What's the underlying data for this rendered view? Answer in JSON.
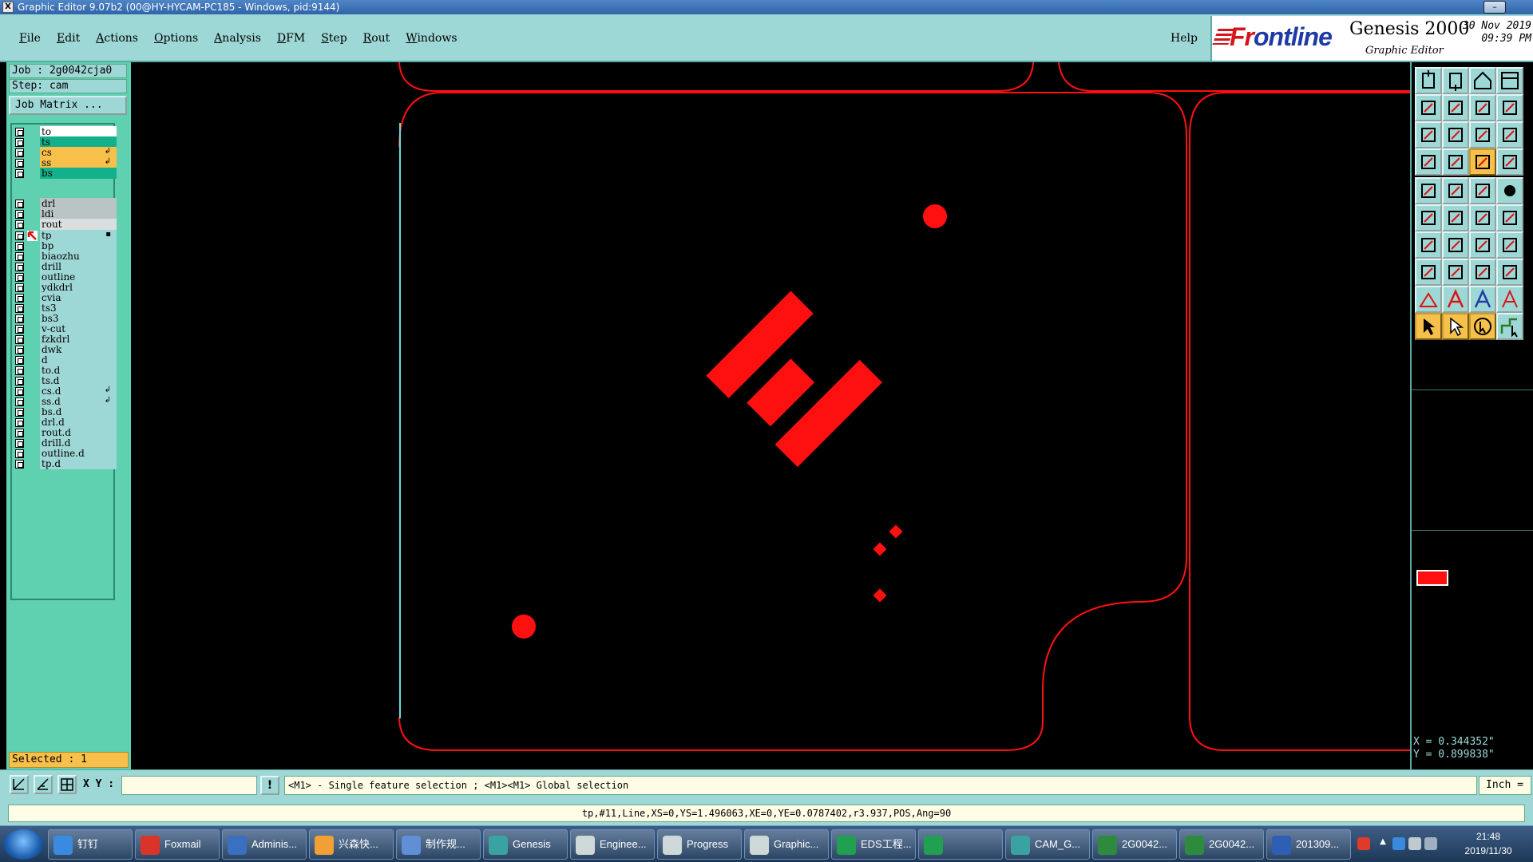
{
  "window": {
    "title": "Graphic Editor 9.07b2 (00@HY-HYCAM-PC185 - Windows, pid:9144)",
    "app_icon": "X"
  },
  "menus": [
    "File",
    "Edit",
    "Actions",
    "Options",
    "Analysis",
    "DFM",
    "Step",
    "Rout",
    "Windows"
  ],
  "help": "Help",
  "brand": {
    "logo": "Frontline",
    "product": "Genesis 2000",
    "subtitle": "Graphic Editor",
    "date": "30 Nov 2019",
    "time": "09:39 PM"
  },
  "job": {
    "job_label": "Job : 2g0042cja0",
    "step_label": "Step: cam",
    "matrix_button": "Job Matrix ..."
  },
  "layers": [
    {
      "name": "to",
      "color": "#ffffff",
      "flag": ""
    },
    {
      "name": "ts",
      "color": "#13b08c",
      "flag": ""
    },
    {
      "name": "cs",
      "color": "#f7c04a",
      "flag": "↲"
    },
    {
      "name": "ss",
      "color": "#f7c04a",
      "flag": "↲"
    },
    {
      "name": "bs",
      "color": "#13b08c",
      "flag": ""
    },
    {
      "name": "drl",
      "color": "#b9c4c4",
      "flag": ""
    },
    {
      "name": "ldi",
      "color": "#b9c4c4",
      "flag": ""
    },
    {
      "name": "rout",
      "color": "#d9dede",
      "flag": ""
    },
    {
      "name": "tp",
      "color": "#9ed8d6",
      "flag": "▪",
      "work": true
    },
    {
      "name": "bp",
      "color": "#9ed8d6",
      "flag": ""
    },
    {
      "name": "biaozhu",
      "color": "#9ed8d6",
      "flag": ""
    },
    {
      "name": "drill",
      "color": "#9ed8d6",
      "flag": ""
    },
    {
      "name": "outline",
      "color": "#9ed8d6",
      "flag": ""
    },
    {
      "name": "ydkdrl",
      "color": "#9ed8d6",
      "flag": ""
    },
    {
      "name": "cvia",
      "color": "#9ed8d6",
      "flag": ""
    },
    {
      "name": "ts3",
      "color": "#9ed8d6",
      "flag": ""
    },
    {
      "name": "bs3",
      "color": "#9ed8d6",
      "flag": ""
    },
    {
      "name": "v-cut",
      "color": "#9ed8d6",
      "flag": ""
    },
    {
      "name": "fzkdrl",
      "color": "#9ed8d6",
      "flag": ""
    },
    {
      "name": "dwk",
      "color": "#9ed8d6",
      "flag": ""
    },
    {
      "name": "d",
      "color": "#9ed8d6",
      "flag": ""
    },
    {
      "name": "to.d",
      "color": "#9ed8d6",
      "flag": ""
    },
    {
      "name": "ts.d",
      "color": "#9ed8d6",
      "flag": ""
    },
    {
      "name": "cs.d",
      "color": "#9ed8d6",
      "flag": "↲"
    },
    {
      "name": "ss.d",
      "color": "#9ed8d6",
      "flag": "↲"
    },
    {
      "name": "bs.d",
      "color": "#9ed8d6",
      "flag": ""
    },
    {
      "name": "drl.d",
      "color": "#9ed8d6",
      "flag": ""
    },
    {
      "name": "rout.d",
      "color": "#9ed8d6",
      "flag": ""
    },
    {
      "name": "drill.d",
      "color": "#9ed8d6",
      "flag": ""
    },
    {
      "name": "outline.d",
      "color": "#9ed8d6",
      "flag": ""
    },
    {
      "name": "tp.d",
      "color": "#9ed8d6",
      "flag": ""
    }
  ],
  "selected": "Selected : 1",
  "tools": [
    [
      "zoom-home-icon",
      "zoom-back-icon",
      "house-icon",
      "window-icon"
    ],
    [
      "pan-left-icon",
      "pan-right-icon",
      "pan-center-icon",
      "scale-icon"
    ],
    [
      "fit-icon",
      "fit-profile-icon",
      "ratio-1-2-icon",
      "help-icon"
    ],
    [
      "snap-icon",
      "grid-icon",
      "net-icon",
      "net-alt-icon"
    ],
    [
      "pad-add-icon",
      "shape-icon",
      "line-ruler-icon",
      "dot-icon"
    ],
    [
      "node-icon",
      "cross-icon",
      "connect-icon",
      "connect-alt-icon"
    ],
    [
      "angle-icon",
      "draw-line-icon",
      "arc-icon",
      "text-icon"
    ],
    [
      "box-point-icon",
      "minus-line-icon",
      "measure-icon",
      "copy-icon"
    ],
    [
      "triangle-icon",
      "a-icon",
      "a-outline-icon",
      "a-alt-icon"
    ],
    [
      "select-arrow-icon",
      "select-alt-icon",
      "select-circle-icon",
      "select-route-icon"
    ]
  ],
  "coords": {
    "x": "X = 0.344352\"",
    "y": "Y = 0.899838\""
  },
  "command": {
    "xy_label": "X Y :",
    "xy_value": "",
    "hint": "<M1> - Single feature selection ; <M1><M1> Global selection",
    "unit": "Inch ="
  },
  "status": "tp,#11,Line,XS=0,YS=1.496063,XE=0,YE=0.0787402,r3.937,POS,Ang=90",
  "taskbar": [
    {
      "label": "钉钉",
      "color": "#3a8be0"
    },
    {
      "label": "Foxmail",
      "color": "#d9342a"
    },
    {
      "label": "Adminis...",
      "color": "#3b6fc2"
    },
    {
      "label": "兴森快...",
      "color": "#f1a035"
    },
    {
      "label": "制作规...",
      "color": "#5f8fd6"
    },
    {
      "label": "Genesis",
      "color": "#3aa2a0"
    },
    {
      "label": "Enginee...",
      "color": "#cfd8d8"
    },
    {
      "label": "Progress",
      "color": "#cfd8d8"
    },
    {
      "label": "Graphic...",
      "color": "#cfd8d8"
    },
    {
      "label": "EDS工程...",
      "color": "#20a050"
    },
    {
      "label": "",
      "color": "#20a050"
    },
    {
      "label": "CAM_G...",
      "color": "#3aa2a0"
    },
    {
      "label": "2G0042...",
      "color": "#2e8b3e"
    },
    {
      "label": "2G0042...",
      "color": "#2e8b3e"
    },
    {
      "label": "201309...",
      "color": "#2f5fb5"
    }
  ],
  "clock": {
    "time": "21:48",
    "date": "2019/11/30"
  },
  "colors": {
    "feature": "#ff0000",
    "panel": "#9ed8d6",
    "highlight": "#f7c04a",
    "profile": "#5fe0e0"
  }
}
